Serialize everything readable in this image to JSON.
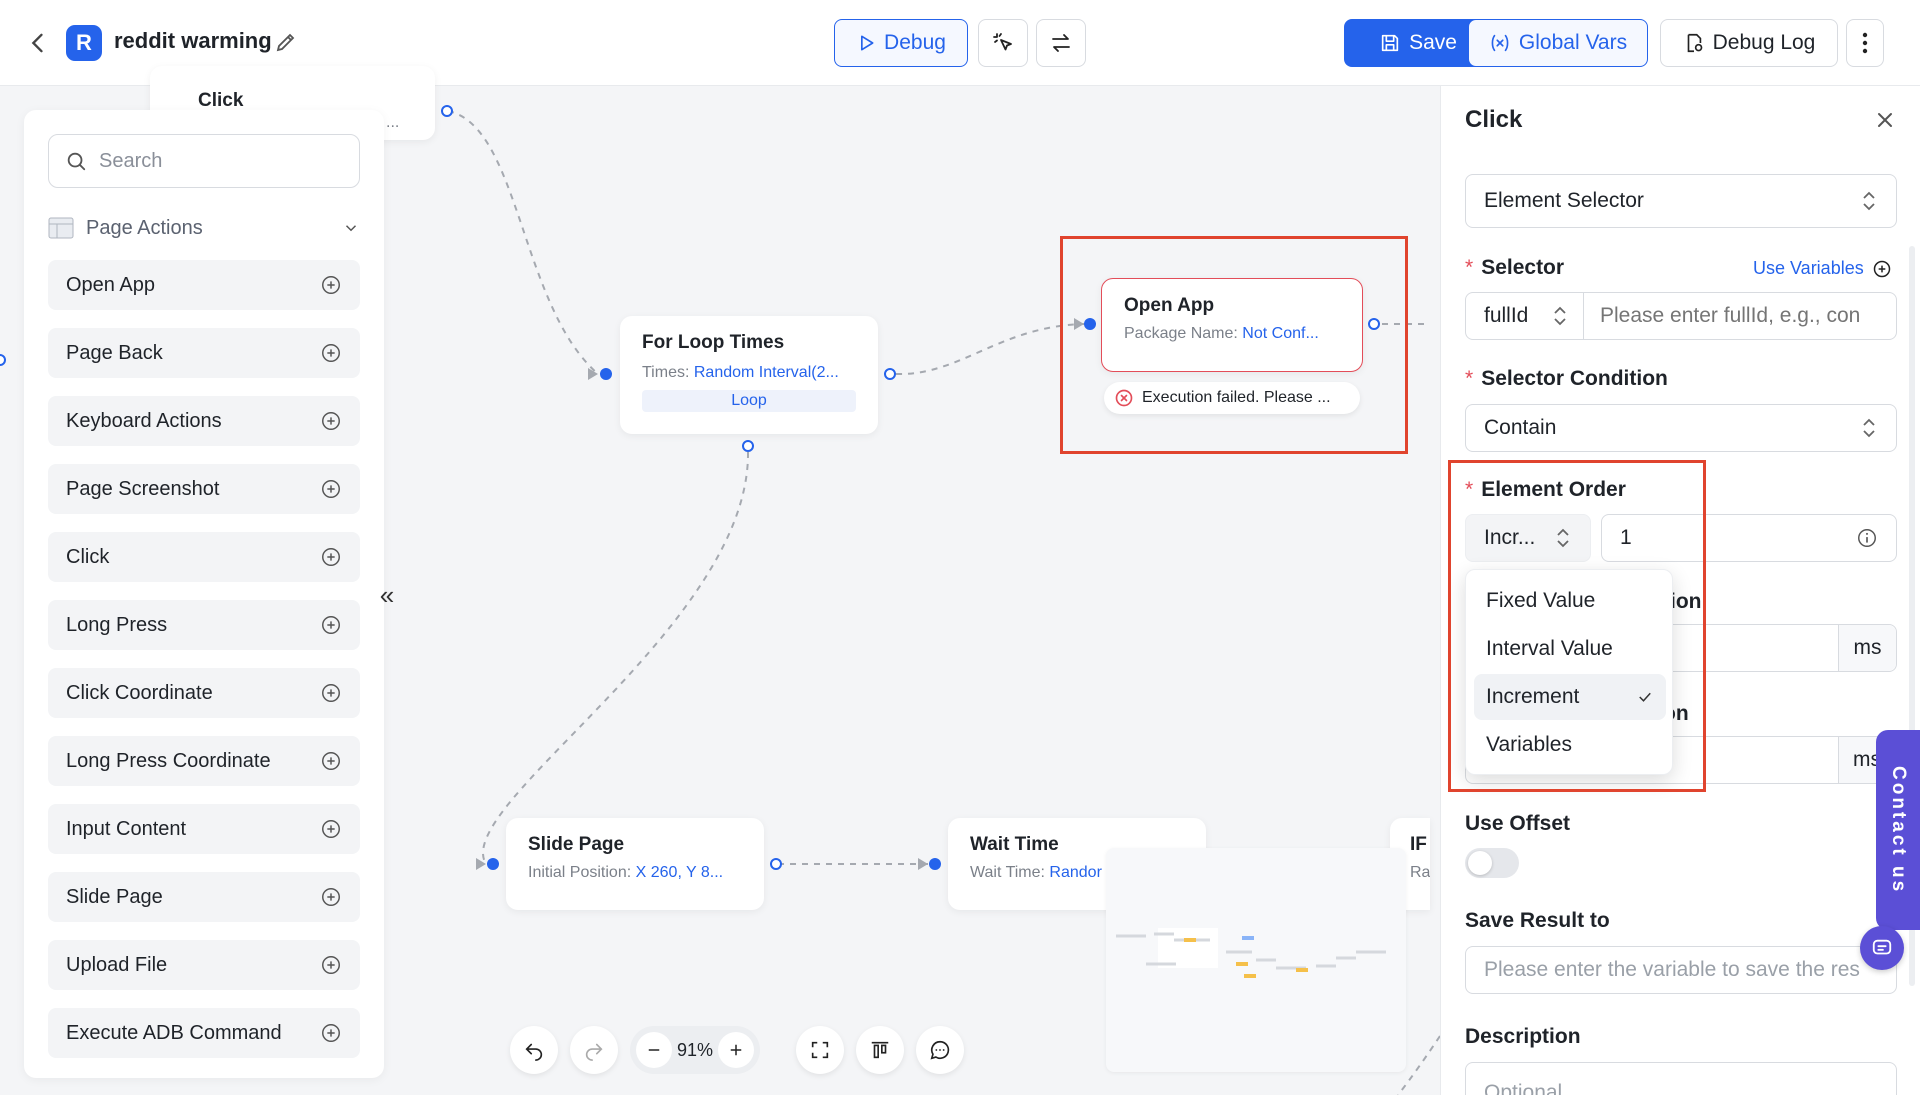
{
  "header": {
    "app_initial": "R",
    "title": "reddit warming",
    "debug_label": "Debug",
    "save_label": "Save",
    "global_vars_label": "Global Vars",
    "debug_log_label": "Debug Log"
  },
  "palette": {
    "search_placeholder": "Search",
    "group_label": "Page Actions",
    "items": [
      {
        "label": "Open App"
      },
      {
        "label": "Page Back"
      },
      {
        "label": "Keyboard Actions"
      },
      {
        "label": "Page Screenshot"
      },
      {
        "label": "Click"
      },
      {
        "label": "Long Press"
      },
      {
        "label": "Click Coordinate"
      },
      {
        "label": "Long Press Coordinate"
      },
      {
        "label": "Input Content"
      },
      {
        "label": "Slide Page"
      },
      {
        "label": "Upload File"
      },
      {
        "label": "Execute ADB Command"
      }
    ]
  },
  "canvas": {
    "click_node": {
      "title": "Click",
      "sub_value": "..."
    },
    "loop_node": {
      "title": "For Loop Times",
      "sub_label": "Times:",
      "sub_value": "Random Interval(2...",
      "badge": "Loop"
    },
    "openapp_node": {
      "title": "Open App",
      "sub_label": "Package Name:",
      "sub_value": "Not Conf...",
      "error": "Execution failed. Please ..."
    },
    "slide_node": {
      "title": "Slide Page",
      "sub_label": "Initial Position:",
      "sub_value": "X 260, Y 8..."
    },
    "wait_node": {
      "title": "Wait Time",
      "sub_label": "Wait Time:",
      "sub_value": "Randor"
    },
    "if_node": {
      "title": "IF",
      "sub_value": "Ra"
    },
    "zoom_label": "91%"
  },
  "panel": {
    "title": "Click",
    "type_select": "Element Selector",
    "selector_label": "Selector",
    "use_variables_label": "Use Variables",
    "selector_type": "fullId",
    "selector_placeholder": "Please enter fullId, e.g., con",
    "condition_label": "Selector Condition",
    "condition_value": "Contain",
    "order_label": "Element Order",
    "order_mode": "Incr...",
    "order_value": "1",
    "hidden_label_1": "tion",
    "hidden_label_2": "on",
    "unit_ms": "ms",
    "unit_ms_2": "ms",
    "offset_label": "Use Offset",
    "save_result_label": "Save Result to",
    "save_result_placeholder": "Please enter the variable to save the res",
    "description_label": "Description",
    "description_placeholder": "Optional",
    "dropdown_options": [
      {
        "label": "Fixed Value",
        "selected": false
      },
      {
        "label": "Interval Value",
        "selected": false
      },
      {
        "label": "Increment",
        "selected": true
      },
      {
        "label": "Variables",
        "selected": false
      }
    ]
  },
  "contact": {
    "label": "Contact us"
  },
  "colors": {
    "accent": "#2563eb",
    "highlight_box": "#e0442e",
    "error": "#e34d59"
  }
}
